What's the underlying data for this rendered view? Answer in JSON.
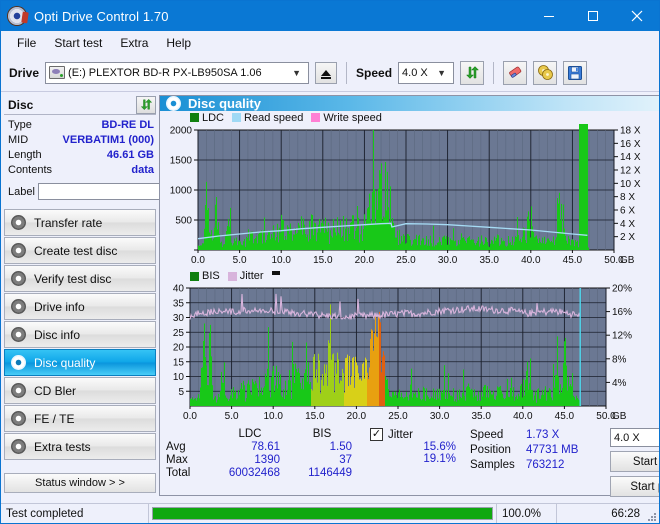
{
  "window": {
    "title": "Opti Drive Control 1.70",
    "icon": "disc-icon",
    "minimize": "minimize-icon",
    "maximize": "maximize-icon",
    "close": "close-icon"
  },
  "menu": {
    "items": [
      "File",
      "Start test",
      "Extra",
      "Help"
    ]
  },
  "toolbar": {
    "drive_label": "Drive",
    "drive_value": "(E:)  PLEXTOR BD-R  PX-LB950SA 1.06",
    "eject_icon": "eject-icon",
    "speed_label": "Speed",
    "speed_value": "4.0 X",
    "refresh_icon": "refresh-icon",
    "erase_icon": "eraser-icon",
    "tools_icon": "gold-discs-icon",
    "save_icon": "floppy-save-icon"
  },
  "disc": {
    "header": "Disc",
    "refresh_icon": "refresh-icon",
    "rows": [
      {
        "key": "Type",
        "value": "BD-RE DL"
      },
      {
        "key": "MID",
        "value": "VERBATIM1 (000)"
      },
      {
        "key": "Length",
        "value": "46.61 GB"
      },
      {
        "key": "Contents",
        "value": "data"
      }
    ],
    "label_key": "Label",
    "label_value": "",
    "label_placeholder": "",
    "label_button_icon": "disc-icon"
  },
  "nav": {
    "items": [
      {
        "label": "Transfer rate",
        "active": false
      },
      {
        "label": "Create test disc",
        "active": false
      },
      {
        "label": "Verify test disc",
        "active": false
      },
      {
        "label": "Drive info",
        "active": false
      },
      {
        "label": "Disc info",
        "active": false
      },
      {
        "label": "Disc quality",
        "active": true
      },
      {
        "label": "CD Bler",
        "active": false
      },
      {
        "label": "FE / TE",
        "active": false
      },
      {
        "label": "Extra tests",
        "active": false
      }
    ],
    "status_window": "Status window > >"
  },
  "panel": {
    "title": "Disc quality",
    "icon": "disc-quality-icon"
  },
  "stats": {
    "columns": [
      "LDC",
      "BIS"
    ],
    "rows": [
      {
        "label": "Avg",
        "ldc": "78.61",
        "bis": "1.50"
      },
      {
        "label": "Max",
        "ldc": "1390",
        "bis": "37"
      },
      {
        "label": "Total",
        "ldc": "60032468",
        "bis": "1146449"
      }
    ],
    "jitter_label": "Jitter",
    "jitter_checked": true,
    "jitter_avg": "15.6%",
    "jitter_max": "19.1%",
    "speed_label": "Speed",
    "speed_value": "1.73 X",
    "position_label": "Position",
    "position_value": "47731 MB",
    "samples_label": "Samples",
    "samples_value": "763212",
    "speed_select": "4.0 X",
    "start_full": "Start full",
    "start_part": "Start part"
  },
  "statusbar": {
    "message": "Test completed",
    "percent": "100.0%",
    "progress": 100,
    "elapsed": "66:28"
  },
  "colors": {
    "accent": "#0a78d4",
    "ldc_green": "#18c818",
    "read_speed": "#a6dcf5",
    "write_speed": "#ff7fd4",
    "jitter_pink": "#d8b4dc",
    "plot_bg": "#6b7893",
    "value_blue": "#2222cc",
    "progress_green": "#10a810"
  },
  "chart_data": [
    {
      "type": "area",
      "id": "ldc-chart",
      "title": "Disc quality",
      "legend": [
        {
          "name": "LDC",
          "color": "#108010"
        },
        {
          "name": "Read speed",
          "color": "#9fd9f5"
        },
        {
          "name": "Write speed",
          "color": "#ff7fd4"
        }
      ],
      "legend_position": "top-left",
      "xlabel": "GB",
      "xlim": [
        0,
        50
      ],
      "xticks": [
        0.0,
        5.0,
        10.0,
        15.0,
        20.0,
        25.0,
        30.0,
        35.0,
        40.0,
        45.0,
        50.0
      ],
      "xticklabels": [
        "0.0",
        "5.0",
        "10.0",
        "15.0",
        "20.0",
        "25.0",
        "30.0",
        "35.0",
        "40.0",
        "45.0",
        "50.0"
      ],
      "ylabel": "LDC",
      "ylim": [
        0,
        2000
      ],
      "yticks": [
        0,
        500,
        1000,
        1500,
        2000
      ],
      "yticklabels": [
        "",
        "500",
        "1000",
        "1500",
        "2000"
      ],
      "y2label": "X",
      "y2lim": [
        0,
        18
      ],
      "y2ticks": [
        2,
        4,
        6,
        8,
        10,
        12,
        14,
        16,
        18
      ],
      "y2ticklabels": [
        "2 X",
        "4 X",
        "6 X",
        "8 X",
        "10 X",
        "12 X",
        "14 X",
        "16 X",
        "18 X"
      ],
      "grid": true,
      "series": [
        {
          "name": "LDC",
          "color": "#18c818",
          "kind": "area-spikes",
          "x": [
            0.2,
            0.6,
            1.0,
            1.4,
            1.6,
            1.9,
            2.2,
            2.6,
            2.9,
            3.2,
            3.6,
            4.0,
            4.4,
            4.8,
            5.2,
            5.6,
            6.0,
            6.4,
            6.9,
            7.3,
            7.7,
            8.1,
            8.5,
            9.0,
            9.4,
            9.8,
            10.2,
            10.6,
            11.0,
            11.5,
            11.9,
            12.3,
            12.7,
            13.1,
            13.6,
            14.0,
            14.4,
            14.8,
            15.2,
            15.6,
            16.1,
            16.5,
            16.9,
            17.3,
            17.7,
            18.2,
            18.6,
            19.0,
            19.4,
            19.8,
            20.2,
            20.7,
            21.1,
            21.5,
            21.9,
            22.3,
            22.6,
            22.9,
            23.1,
            23.3,
            23.5,
            23.9,
            24.3,
            24.8,
            25.2,
            25.6,
            26.0,
            26.4,
            26.9,
            27.3,
            27.7,
            28.1,
            28.5,
            29.0,
            29.4,
            29.8,
            30.2,
            30.6,
            31.0,
            31.5,
            31.9,
            32.3,
            32.7,
            33.1,
            33.6,
            34.0,
            34.4,
            34.8,
            35.2,
            35.6,
            36.1,
            36.5,
            36.9,
            37.3,
            37.7,
            38.2,
            38.6,
            39.0,
            39.4,
            39.8,
            40.2,
            40.7,
            41.1,
            41.5,
            41.9,
            42.3,
            42.8,
            43.2,
            43.6,
            44.0,
            44.4,
            44.9,
            45.3,
            45.7,
            46.1,
            46.5,
            46.8
          ],
          "values": [
            60,
            110,
            1290,
            520,
            260,
            330,
            1150,
            200,
            140,
            170,
            520,
            130,
            160,
            190,
            180,
            150,
            210,
            250,
            200,
            230,
            300,
            290,
            260,
            320,
            330,
            280,
            420,
            300,
            340,
            360,
            330,
            480,
            360,
            340,
            430,
            410,
            390,
            420,
            540,
            380,
            400,
            460,
            420,
            440,
            400,
            430,
            470,
            460,
            480,
            520,
            620,
            700,
            1010,
            900,
            1250,
            1220,
            960,
            1390,
            700,
            420,
            320,
            240,
            300,
            170,
            230,
            180,
            330,
            200,
            150,
            210,
            180,
            200,
            150,
            230,
            170,
            190,
            160,
            210,
            180,
            250,
            170,
            200,
            160,
            220,
            180,
            190,
            160,
            200,
            170,
            210,
            180,
            200,
            160,
            190,
            170,
            220,
            180,
            430,
            210,
            1010,
            300,
            180,
            200,
            230,
            170,
            210,
            190,
            1010,
            1260,
            300,
            200,
            180,
            160,
            140
          ]
        },
        {
          "name": "Read speed",
          "color": "#a6dcf5",
          "kind": "line",
          "x": [
            0.0,
            2.5,
            5.0,
            7.5,
            10.0,
            12.5,
            15.0,
            17.5,
            20.0,
            22.0,
            23.2,
            23.3,
            25.0,
            27.5,
            30.0,
            32.5,
            35.0,
            37.5,
            40.0,
            42.5,
            45.0,
            46.8
          ],
          "values": [
            1.7,
            2.1,
            2.4,
            2.7,
            2.9,
            3.2,
            3.4,
            3.6,
            3.8,
            3.95,
            4.0,
            3.45,
            3.95,
            3.9,
            3.8,
            3.6,
            3.4,
            3.2,
            3.0,
            2.7,
            2.4,
            2.2
          ]
        }
      ]
    },
    {
      "type": "area",
      "id": "bis-chart",
      "legend": [
        {
          "name": "BIS",
          "color": "#108010"
        },
        {
          "name": "Jitter",
          "color": "#d8b4dc"
        }
      ],
      "legend_position": "top-left",
      "xlabel": "GB",
      "xlim": [
        0,
        50
      ],
      "xticks": [
        0.0,
        5.0,
        10.0,
        15.0,
        20.0,
        25.0,
        30.0,
        35.0,
        40.0,
        45.0,
        50.0
      ],
      "xticklabels": [
        "0.0",
        "5.0",
        "10.0",
        "15.0",
        "20.0",
        "25.0",
        "30.0",
        "35.0",
        "40.0",
        "45.0",
        "50.0"
      ],
      "ylabel": "BIS",
      "ylim": [
        0,
        40
      ],
      "yticks": [
        5,
        10,
        15,
        20,
        25,
        30,
        35,
        40
      ],
      "yticklabels": [
        "5",
        "10",
        "15",
        "20",
        "25",
        "30",
        "35",
        "40"
      ],
      "y2label": "%",
      "y2lim": [
        0,
        20
      ],
      "y2ticks": [
        4,
        8,
        12,
        16,
        20
      ],
      "y2ticklabels": [
        "4%",
        "8%",
        "12%",
        "16%",
        "20%"
      ],
      "grid": true,
      "series": [
        {
          "name": "BIS",
          "color": "#18c818",
          "kind": "area-spikes",
          "x": [
            0.2,
            0.6,
            1.0,
            1.4,
            1.7,
            2.0,
            2.4,
            2.7,
            3.0,
            3.4,
            3.8,
            4.2,
            4.6,
            5.0,
            5.4,
            5.8,
            6.2,
            6.6,
            7.0,
            7.4,
            7.8,
            8.2,
            8.6,
            9.0,
            9.4,
            9.8,
            10.2,
            10.6,
            11.0,
            11.4,
            11.8,
            12.2,
            12.6,
            13.0,
            13.4,
            13.8,
            14.2,
            14.6,
            15.0,
            15.4,
            15.8,
            16.2,
            16.6,
            17.0,
            17.4,
            17.8,
            18.2,
            18.6,
            19.0,
            19.4,
            19.8,
            20.2,
            20.6,
            21.0,
            21.4,
            21.8,
            22.0,
            22.2,
            22.5,
            22.8,
            23.0,
            23.2,
            23.4,
            23.6,
            24.0,
            24.4,
            24.8,
            25.4,
            26.0,
            26.6,
            27.2,
            27.8,
            28.4,
            29.0,
            29.6,
            30.2,
            30.8,
            31.4,
            32.0,
            32.6,
            33.2,
            33.8,
            34.4,
            35.0,
            35.6,
            36.2,
            36.8,
            37.4,
            38.0,
            38.6,
            39.2,
            39.8,
            40.4,
            41.0,
            41.6,
            42.2,
            42.8,
            43.4,
            44.0,
            44.6,
            45.0,
            45.4,
            45.8,
            46.2,
            46.6
          ],
          "values": [
            2,
            3,
            4,
            12,
            27,
            5,
            23,
            4,
            3,
            5,
            12,
            4,
            3,
            5,
            4,
            6,
            8,
            5,
            9,
            7,
            6,
            10,
            7,
            9,
            11,
            8,
            17,
            9,
            10,
            8,
            12,
            9,
            13,
            10,
            8,
            9,
            11,
            9,
            17,
            13,
            15,
            12,
            17,
            16,
            14,
            13,
            17,
            12,
            15,
            11,
            16,
            13,
            15,
            19,
            21,
            25,
            20,
            26,
            24,
            37,
            30,
            22,
            9,
            7,
            6,
            5,
            4,
            5,
            4,
            6,
            5,
            4,
            6,
            5,
            4,
            5,
            6,
            4,
            5,
            4,
            6,
            5,
            4,
            6,
            5,
            4,
            5,
            6,
            4,
            5,
            4,
            6,
            12,
            5,
            4,
            5,
            6,
            5,
            19,
            8,
            24,
            10,
            5,
            4,
            3
          ]
        },
        {
          "name": "Jitter",
          "color": "#d8b4dc",
          "kind": "line-noisy",
          "x": [
            0.0,
            1.0,
            2.0,
            3.0,
            4.0,
            5.0,
            6.0,
            7.0,
            8.0,
            9.0,
            10.0,
            11.0,
            12.0,
            13.0,
            14.0,
            15.0,
            16.0,
            17.0,
            18.0,
            19.0,
            20.0,
            21.0,
            22.0,
            23.0,
            24.0,
            25.0,
            26.0,
            27.0,
            28.0,
            29.0,
            30.0,
            31.0,
            32.0,
            33.0,
            34.0,
            35.0,
            36.0,
            37.0,
            38.0,
            39.0,
            40.0,
            41.0,
            42.0,
            43.0,
            44.0,
            45.0,
            46.0,
            46.8
          ],
          "values": [
            30.0,
            31.6,
            31.8,
            31.9,
            32.2,
            31.8,
            32.1,
            32.4,
            32.3,
            32.0,
            32.2,
            31.7,
            31.6,
            31.3,
            31.2,
            31.0,
            30.6,
            30.5,
            30.3,
            30.2,
            30.4,
            30.5,
            30.6,
            30.8,
            31.0,
            31.2,
            31.4,
            31.3,
            31.5,
            31.9,
            32.2,
            32.5,
            32.6,
            32.8,
            33.0,
            32.9,
            32.6,
            32.5,
            32.4,
            32.2,
            31.5,
            31.4,
            31.8,
            32.0,
            32.1,
            31.6,
            31.2,
            30.4
          ]
        }
      ],
      "annotations": [
        {
          "type": "vline",
          "x": 46.9,
          "color": "#4fd8ee",
          "label": "end-of-data-marker"
        },
        {
          "type": "burst-region",
          "x0": 14.5,
          "x1": 23.4,
          "note": "BIS bars shift yellow/orange (elevated error region)"
        }
      ]
    }
  ]
}
